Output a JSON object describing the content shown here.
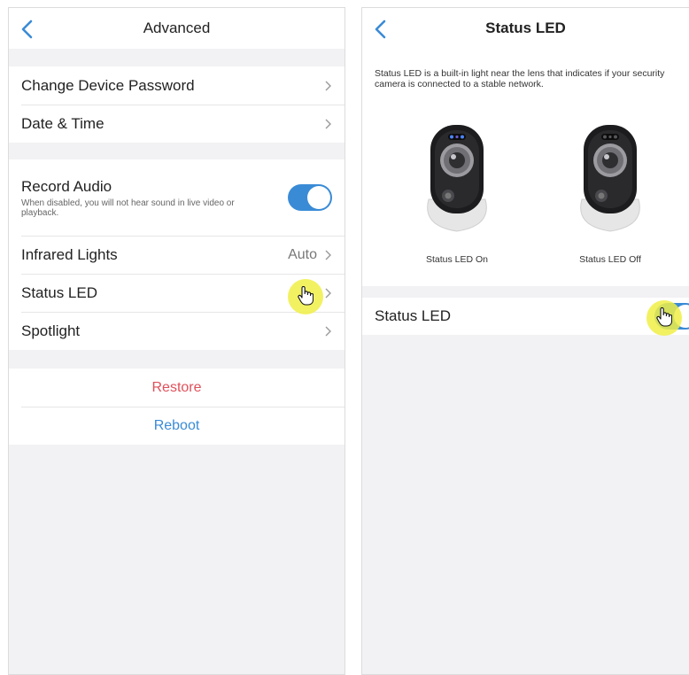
{
  "left": {
    "title": "Advanced",
    "rows": [
      {
        "label": "Change Device Password"
      },
      {
        "label": "Date & Time"
      }
    ],
    "record_audio": {
      "label": "Record Audio",
      "hint": "When disabled, you will not hear sound in live video or playback.",
      "enabled": true
    },
    "settings": [
      {
        "label": "Infrared Lights",
        "value": "Auto"
      },
      {
        "label": "Status LED",
        "value": ""
      },
      {
        "label": "Spotlight",
        "value": ""
      }
    ],
    "restore_label": "Restore",
    "reboot_label": "Reboot"
  },
  "right": {
    "title": "Status LED",
    "description": "Status LED is a built-in light near the lens that indicates if your security camera is connected to a stable network.",
    "captions": {
      "on": "Status LED On",
      "off": "Status LED Off"
    },
    "toggle_label": "Status LED",
    "toggle_enabled": true
  },
  "colors": {
    "accent": "#3a8bd6",
    "destructive": "#e0505a",
    "cursor": "#f0ee46"
  },
  "icons": [
    "back-icon",
    "chevron-right-icon",
    "hand-pointer-icon"
  ]
}
